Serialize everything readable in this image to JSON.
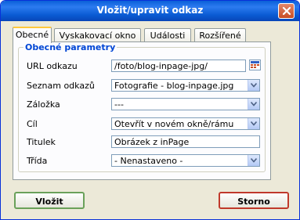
{
  "window": {
    "title": "Vložit/upravit odkaz"
  },
  "tabs": [
    {
      "label": "Obecné",
      "active": true
    },
    {
      "label": "Vyskakovací okno",
      "active": false
    },
    {
      "label": "Události",
      "active": false
    },
    {
      "label": "Rozšířené",
      "active": false
    }
  ],
  "group": {
    "legend": "Obecné parametry"
  },
  "fields": {
    "url": {
      "label": "URL odkazu",
      "value": "/foto/blog-inpage-jpg/"
    },
    "link_list": {
      "label": "Seznam odkazů",
      "value": "Fotografie - blog-inpage.jpg"
    },
    "anchor": {
      "label": "Záložka",
      "value": "---"
    },
    "target": {
      "label": "Cíl",
      "value": "Otevřít v novém okně/rámu"
    },
    "title": {
      "label": "Titulek",
      "value": "Obrázek z inPage"
    },
    "class": {
      "label": "Třída",
      "value": "- Nenastaveno -"
    }
  },
  "buttons": {
    "insert": "Vložit",
    "cancel": "Storno"
  },
  "colors": {
    "titlebar": "#0a5fd8",
    "legend": "#0046d5",
    "tab_highlight": "#ffc83c",
    "insert_border": "#6aa15a",
    "cancel_border": "#c0392b"
  },
  "icons": {
    "close": "close-icon",
    "browse": "browse-icon",
    "dropdown": "chevron-down-icon"
  }
}
